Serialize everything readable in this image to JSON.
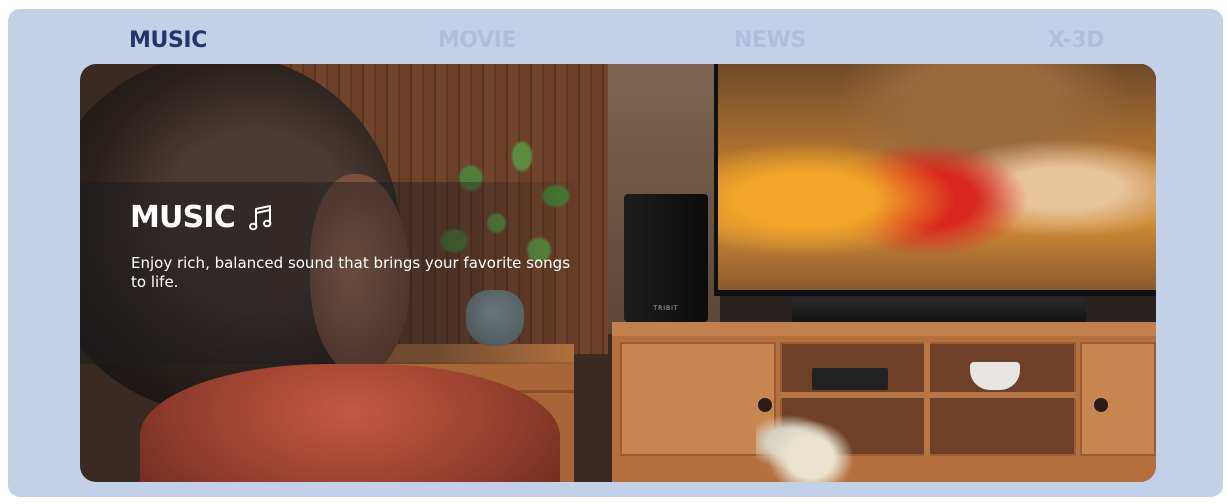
{
  "tabs": [
    {
      "label": "MUSIC",
      "active": true
    },
    {
      "label": "MOVIE",
      "active": false
    },
    {
      "label": "NEWS",
      "active": false
    },
    {
      "label": "X-3D",
      "active": false
    }
  ],
  "feature": {
    "title": "MUSIC",
    "icon": "music-note-icon",
    "description": "Enjoy rich, balanced sound that brings your favorite songs to life."
  },
  "scene": {
    "subwoofer_brand": "TRIBIT"
  },
  "colors": {
    "panel_bg": "#c3d1e8",
    "tab_active": "#23356a",
    "tab_inactive": "#aebfdc"
  }
}
